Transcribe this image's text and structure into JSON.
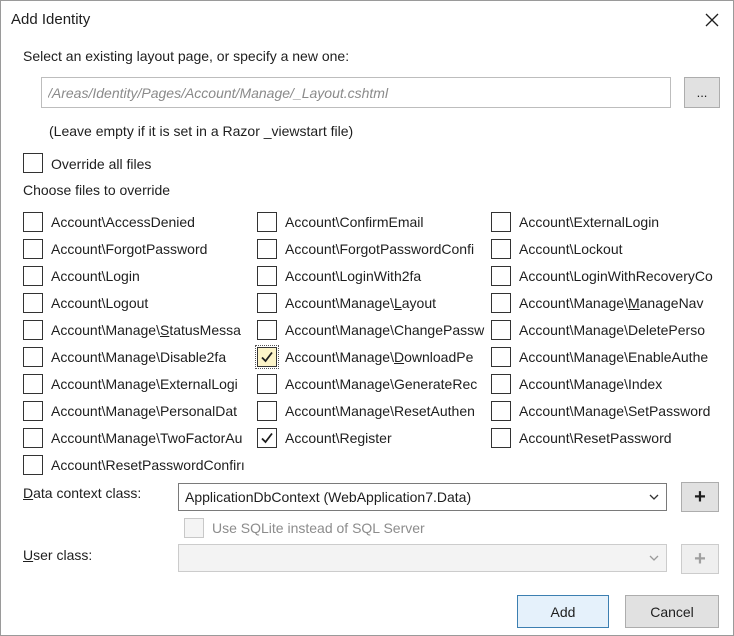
{
  "dialog": {
    "title": "Add Identity"
  },
  "layout": {
    "prompt": "Select an existing layout page, or specify a new one:",
    "placeholder": "/Areas/Identity/Pages/Account/Manage/_Layout.cshtml",
    "browse_label": "...",
    "hint": "(Leave empty if it is set in a Razor _viewstart file)"
  },
  "override_all": {
    "label": "Override all files",
    "checked": false
  },
  "files_heading": "Choose files to override",
  "files": [
    {
      "label": "Account\\AccessDenied",
      "checked": false
    },
    {
      "label": "Account\\ConfirmEmail",
      "checked": false
    },
    {
      "label": "Account\\ExternalLogin",
      "checked": false
    },
    {
      "label": "Account\\ForgotPassword",
      "checked": false
    },
    {
      "label": "Account\\ForgotPasswordConfi",
      "checked": false
    },
    {
      "label": "Account\\Lockout",
      "checked": false
    },
    {
      "label": "Account\\Login",
      "checked": false
    },
    {
      "label": "Account\\LoginWith2fa",
      "checked": false
    },
    {
      "label": "Account\\LoginWithRecoveryCo",
      "checked": false
    },
    {
      "label": "Account\\Logout",
      "checked": false
    },
    {
      "label": "Account\\Manage\\Layout",
      "checked": false,
      "underline_index": 15
    },
    {
      "label": "Account\\Manage\\ManageNav",
      "checked": false,
      "underline_index": 15
    },
    {
      "label": "Account\\Manage\\StatusMessa",
      "checked": false,
      "underline_index": 15
    },
    {
      "label": "Account\\Manage\\ChangePassw",
      "checked": false
    },
    {
      "label": "Account\\Manage\\DeletePerso",
      "checked": false
    },
    {
      "label": "Account\\Manage\\Disable2fa",
      "checked": false
    },
    {
      "label": "Account\\Manage\\DownloadPe",
      "checked": true,
      "focused": true,
      "underline_index": 15
    },
    {
      "label": "Account\\Manage\\EnableAuthe",
      "checked": false
    },
    {
      "label": "Account\\Manage\\ExternalLogi",
      "checked": false
    },
    {
      "label": "Account\\Manage\\GenerateRec",
      "checked": false
    },
    {
      "label": "Account\\Manage\\Index",
      "checked": false
    },
    {
      "label": "Account\\Manage\\PersonalDat",
      "checked": false
    },
    {
      "label": "Account\\Manage\\ResetAuthen",
      "checked": false
    },
    {
      "label": "Account\\Manage\\SetPassword",
      "checked": false
    },
    {
      "label": "Account\\Manage\\TwoFactorAu",
      "checked": false
    },
    {
      "label": "Account\\Register",
      "checked": true
    },
    {
      "label": "Account\\ResetPassword",
      "checked": false
    },
    {
      "label": "Account\\ResetPasswordConfirı",
      "checked": false
    }
  ],
  "data_context": {
    "label": "Data context class:",
    "value": "ApplicationDbContext (WebApplication7.Data)",
    "add_label": "+"
  },
  "sqlite": {
    "label": "Use SQLite instead of SQL Server",
    "checked": false,
    "enabled": false
  },
  "user_class": {
    "label": "User class:",
    "value": "",
    "add_label": "+"
  },
  "footer": {
    "add_label": "Add",
    "cancel_label": "Cancel"
  }
}
